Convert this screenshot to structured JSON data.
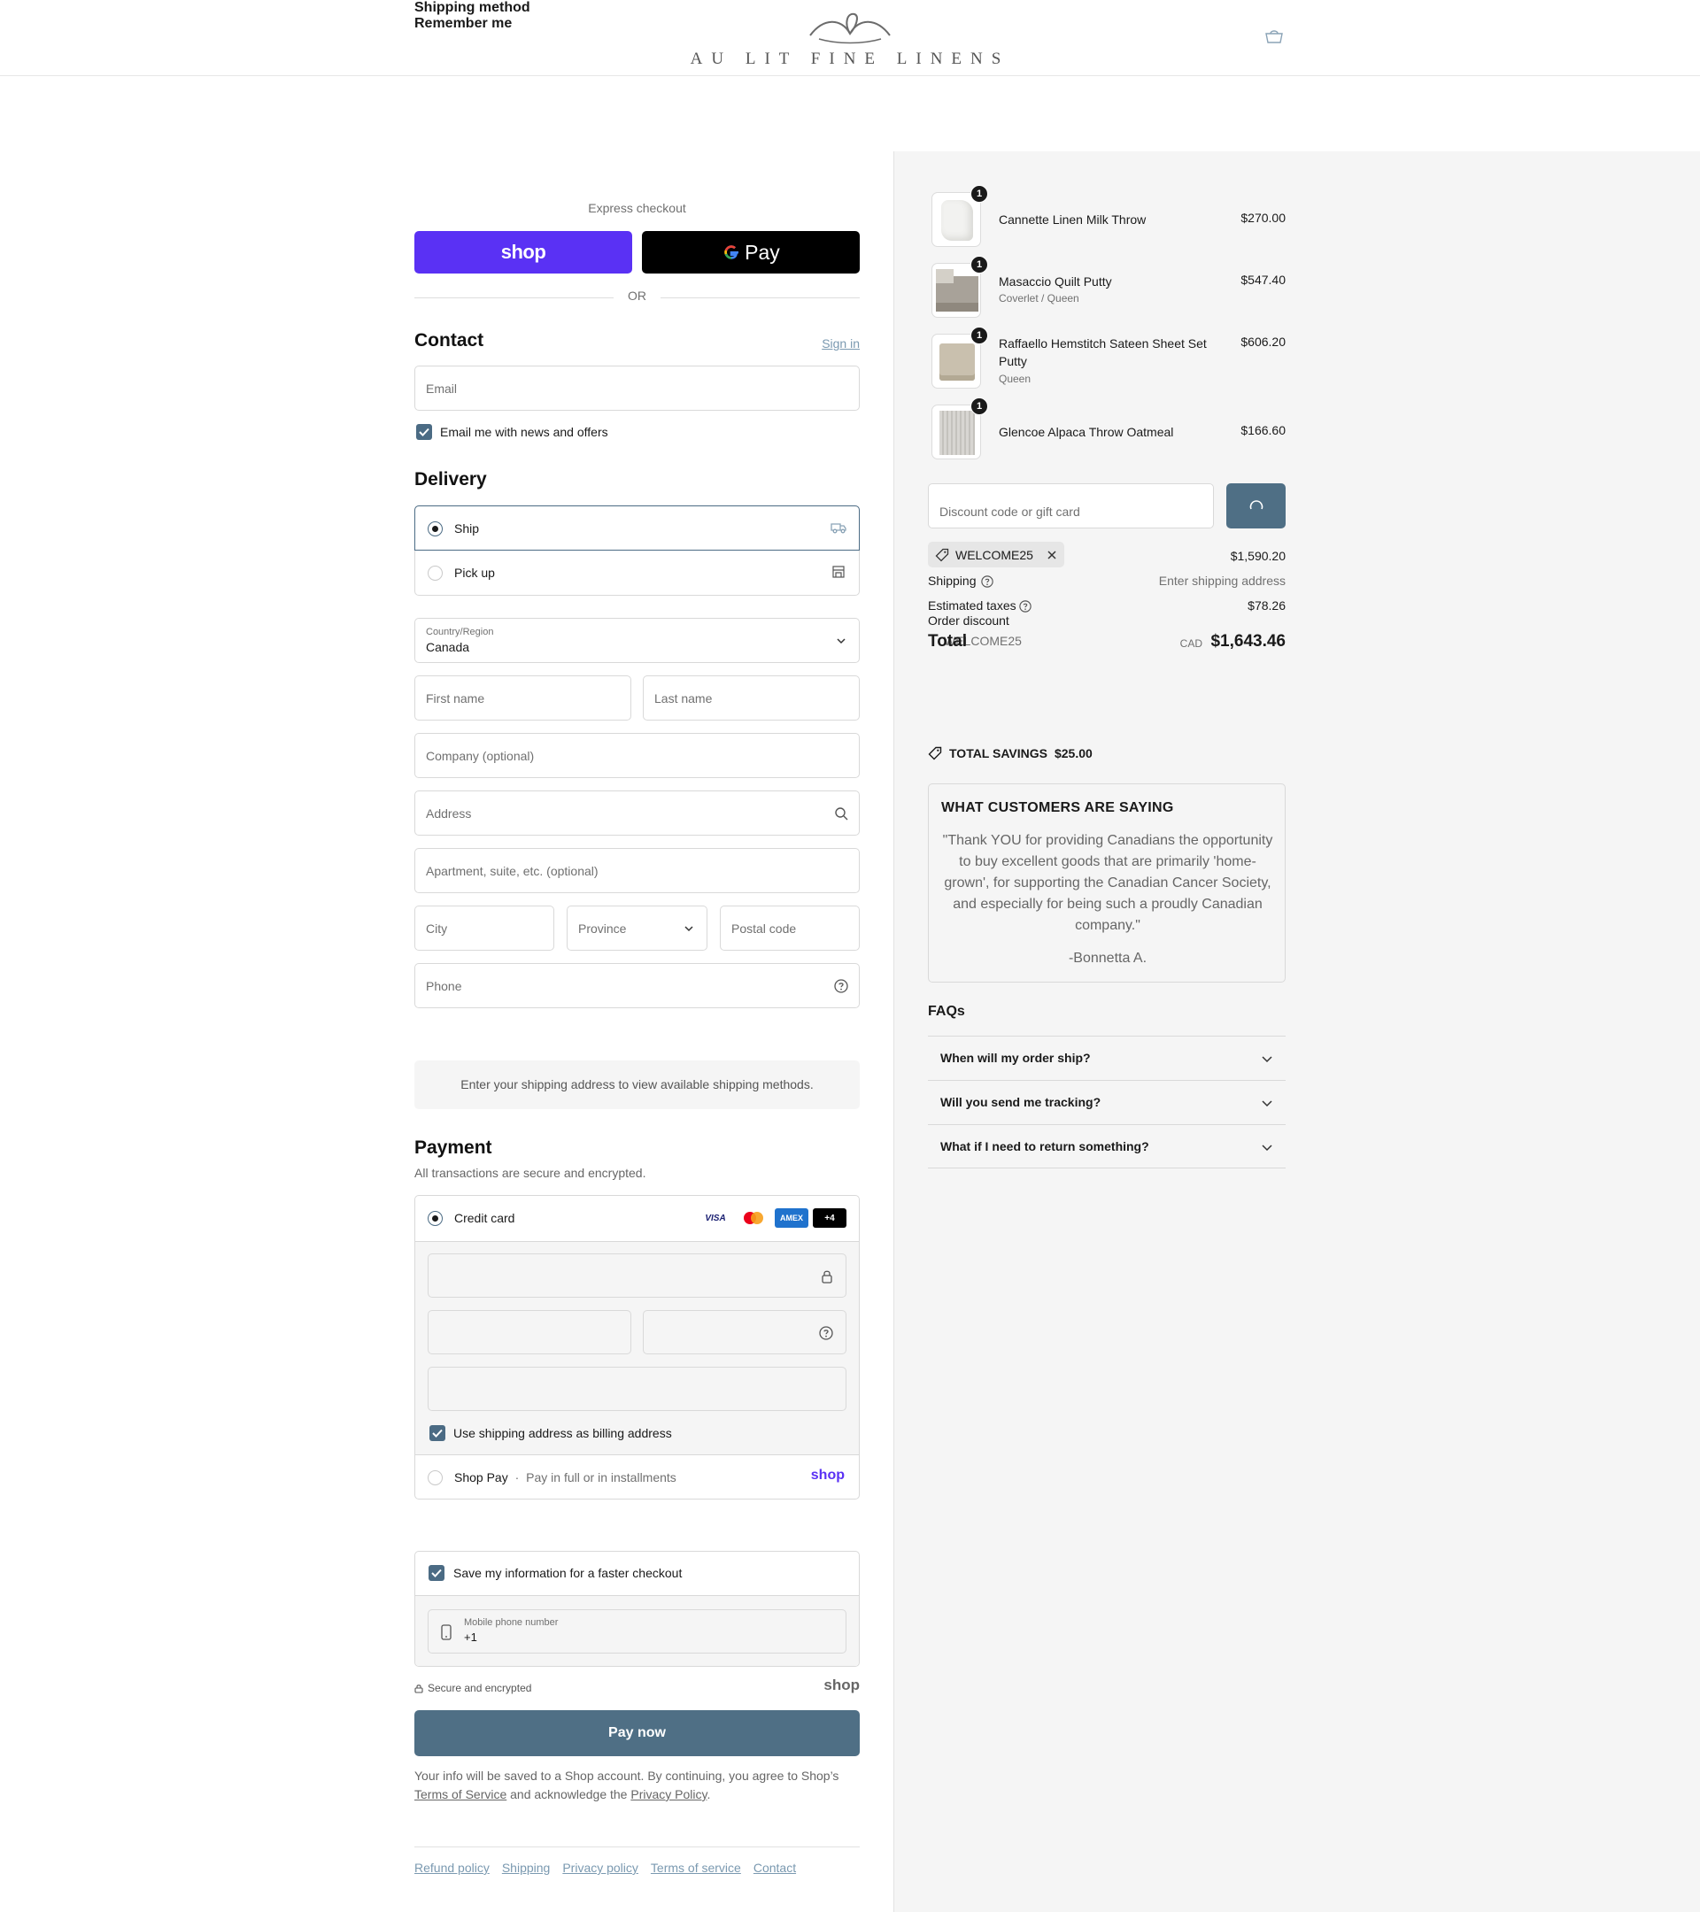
{
  "header": {
    "logo_text": "AU LIT FINE LINENS",
    "icons": {
      "logo": "flourish-logo-icon",
      "cart": "shopping-bag-icon"
    }
  },
  "express": {
    "label": "Express checkout",
    "shop_pay_label": "shop",
    "gpay_label": "Pay",
    "or": "OR"
  },
  "contact": {
    "title": "Contact",
    "sign_in": "Sign in",
    "email_placeholder": "Email",
    "news_checkbox_label": "Email me with news and offers",
    "news_checked": true
  },
  "delivery": {
    "title": "Delivery",
    "options": [
      {
        "label": "Ship",
        "selected": true,
        "icon": "truck-icon"
      },
      {
        "label": "Pick up",
        "selected": false,
        "icon": "store-icon"
      }
    ],
    "country_label": "Country/Region",
    "country_value": "Canada",
    "first_name": "First name",
    "last_name": "Last name",
    "company": "Company (optional)",
    "address": "Address",
    "apartment": "Apartment, suite, etc. (optional)",
    "city": "City",
    "province": "Province",
    "postal": "Postal code",
    "phone": "Phone"
  },
  "shipping_method": {
    "title": "Shipping method",
    "note": "Enter your shipping address to view available shipping methods."
  },
  "payment": {
    "title": "Payment",
    "subtitle": "All transactions are secure and encrypted.",
    "credit_card_label": "Credit card",
    "card_brands": [
      "VISA",
      "mastercard",
      "AMEX",
      "+4"
    ],
    "billing_checkbox_label": "Use shipping address as billing address",
    "billing_checked": true,
    "shop_pay_label": "Shop Pay",
    "shop_pay_sep": "·",
    "shop_pay_desc": "Pay in full or in installments",
    "shop_pay_logo": "shop"
  },
  "remember": {
    "title": "Remember me",
    "save_label": "Save my information for a faster checkout",
    "save_checked": true,
    "mobile_label": "Mobile phone number",
    "mobile_value": "+1",
    "secure_text": "Secure and encrypted",
    "shop_logo": "shop"
  },
  "pay_button": "Pay now",
  "legal": {
    "prefix": "Your info will be saved to a Shop account. By continuing, you agree to Shop’s ",
    "terms": "Terms of Service",
    "middle": " and acknowledge the ",
    "privacy": "Privacy Policy",
    "suffix": "."
  },
  "footer_links": [
    "Refund policy",
    "Shipping",
    "Privacy policy",
    "Terms of service",
    "Contact"
  ],
  "summary": {
    "items": [
      {
        "name": "Cannette Linen Milk Throw",
        "variant": "",
        "price": "$270.00",
        "qty": "1"
      },
      {
        "name": "Masaccio Quilt Putty",
        "variant": "Coverlet / Queen",
        "price": "$547.40",
        "qty": "1"
      },
      {
        "name": "Raffaello Hemstitch Sateen Sheet Set Putty",
        "variant": "Queen",
        "price": "$606.20",
        "qty": "1"
      },
      {
        "name": "Glencoe Alpaca Throw Oatmeal",
        "variant": "",
        "price": "$166.60",
        "qty": "1"
      }
    ],
    "discount_placeholder": "Discount code or gift card",
    "applied_code": "WELCOME25",
    "subtotal_value": "$1,590.20",
    "shipping_label": "Shipping",
    "shipping_value": "Enter shipping address",
    "taxes_label": "Estimated taxes",
    "taxes_value": "$78.26",
    "order_discount_label": "Order discount",
    "order_discount_code": "WELCOME25",
    "total_label": "Total",
    "total_currency": "CAD",
    "total_value": "$1,643.46",
    "savings_label": "TOTAL SAVINGS",
    "savings_value": "$25.00"
  },
  "testimonial": {
    "title": "WHAT CUSTOMERS ARE SAYING",
    "quote": "\"Thank YOU for providing Canadians the opportunity to buy excellent goods that are primarily 'home-grown', for supporting the Canadian Cancer Society, and especially for being such a proudly Canadian company.\"",
    "author": "-Bonnetta A."
  },
  "faqs": {
    "title": "FAQs",
    "items": [
      "When will my order ship?",
      "Will you send me tracking?",
      "What if I need to return something?"
    ]
  },
  "colors": {
    "shop_purple": "#5a31f4",
    "accent_slate": "#4f6f85",
    "link": "#7a99b0",
    "summary_bg": "#f5f5f5"
  }
}
